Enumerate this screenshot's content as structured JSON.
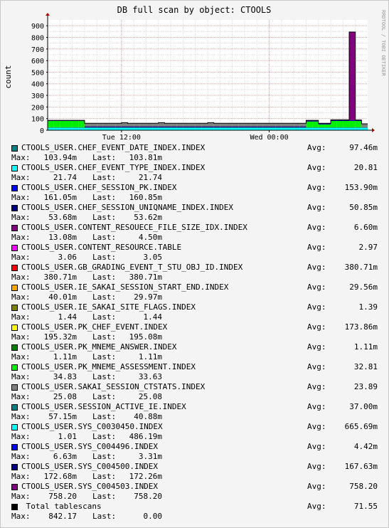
{
  "chart_data": {
    "type": "area",
    "title": "DB full scan by object: CTOOLS",
    "ylabel": "count",
    "watermark": "RRDTOOL / TOBI OETIKER",
    "ylim": [
      0,
      950
    ],
    "yticks": [
      0,
      100,
      200,
      300,
      400,
      500,
      600,
      700,
      800,
      900
    ],
    "ytick_labels": [
      "0",
      "100",
      "200",
      "300",
      "400",
      "500",
      "600",
      "700",
      "800",
      "900"
    ],
    "xlim": [
      0,
      52
    ],
    "xticks": [
      {
        "x": 12,
        "label": "Tue 12:00"
      },
      {
        "x": 36,
        "label": "Wed 00:00"
      }
    ],
    "grid": true,
    "x": [
      0,
      1,
      2,
      3,
      4,
      5,
      6,
      7,
      8,
      9,
      10,
      11,
      12,
      13,
      14,
      15,
      16,
      17,
      18,
      19,
      20,
      21,
      22,
      23,
      24,
      25,
      26,
      27,
      28,
      29,
      30,
      31,
      32,
      33,
      34,
      35,
      36,
      37,
      38,
      39,
      40,
      41,
      42,
      43,
      44,
      45,
      46,
      47,
      48,
      49,
      50,
      51
    ],
    "series": [
      {
        "name": "CTOOLS_USER.SYS_C0030450.INDEX",
        "color": "#00ffff",
        "values": [
          20,
          20,
          20,
          20,
          20,
          20,
          20,
          20,
          20,
          20,
          20,
          20,
          20,
          20,
          20,
          20,
          20,
          20,
          20,
          20,
          20,
          20,
          20,
          20,
          20,
          20,
          20,
          20,
          20,
          20,
          20,
          20,
          20,
          20,
          20,
          20,
          20,
          20,
          20,
          20,
          20,
          20,
          20,
          20,
          20,
          20,
          20,
          20,
          20,
          20,
          20,
          20
        ]
      },
      {
        "name": "CTOOLS_USER.SESSION_ACTIVE_IE.INDEX",
        "color": "#008080",
        "values": [
          5,
          5,
          5,
          5,
          5,
          5,
          5,
          5,
          5,
          5,
          5,
          5,
          5,
          5,
          5,
          5,
          5,
          5,
          5,
          5,
          5,
          5,
          5,
          5,
          5,
          5,
          5,
          5,
          5,
          5,
          5,
          5,
          5,
          5,
          5,
          5,
          5,
          5,
          5,
          5,
          5,
          5,
          5,
          5,
          5,
          5,
          5,
          5,
          5,
          5,
          5,
          5
        ]
      },
      {
        "name": "CTOOLS_USER.PK_MNEME_ASSESSMENT.INDEX",
        "color": "#00ee00",
        "values": [
          55,
          55,
          55,
          55,
          55,
          55,
          0,
          0,
          0,
          0,
          0,
          0,
          0,
          0,
          0,
          0,
          0,
          0,
          0,
          0,
          0,
          0,
          0,
          0,
          0,
          0,
          0,
          0,
          0,
          0,
          0,
          0,
          0,
          0,
          0,
          0,
          0,
          0,
          0,
          0,
          0,
          0,
          50,
          50,
          25,
          25,
          55,
          55,
          55,
          55,
          55,
          0
        ]
      },
      {
        "name": "CTOOLS_USER.CHEF_SESSION_UNIQNAME_INDEX.INDEX",
        "color": "#000080",
        "values": [
          3,
          3,
          3,
          3,
          3,
          3,
          8,
          8,
          8,
          8,
          8,
          8,
          8,
          8,
          8,
          8,
          8,
          8,
          8,
          8,
          8,
          8,
          8,
          8,
          8,
          8,
          8,
          8,
          8,
          8,
          8,
          8,
          8,
          8,
          8,
          8,
          8,
          8,
          8,
          8,
          8,
          8,
          8,
          8,
          8,
          8,
          8,
          8,
          8,
          8,
          8,
          0
        ]
      },
      {
        "name": "CTOOLS_USER.SAKAI_SESSION_CTSTATS.INDEX",
        "color": "#808080",
        "values": [
          0,
          0,
          0,
          0,
          0,
          0,
          25,
          25,
          25,
          25,
          25,
          25,
          30,
          25,
          25,
          25,
          25,
          25,
          30,
          25,
          25,
          25,
          25,
          25,
          25,
          25,
          30,
          25,
          25,
          25,
          25,
          25,
          25,
          25,
          25,
          25,
          25,
          25,
          25,
          25,
          25,
          25,
          0,
          0,
          0,
          0,
          0,
          0,
          0,
          0,
          0,
          30
        ]
      },
      {
        "name": "CTOOLS_USER.SYS_C004503.INDEX",
        "color": "#800080",
        "values": [
          2,
          2,
          2,
          2,
          2,
          2,
          2,
          2,
          2,
          2,
          2,
          2,
          2,
          2,
          2,
          2,
          2,
          2,
          2,
          2,
          2,
          2,
          2,
          2,
          2,
          2,
          2,
          2,
          2,
          2,
          2,
          2,
          2,
          2,
          2,
          2,
          2,
          2,
          2,
          2,
          2,
          2,
          2,
          2,
          2,
          2,
          2,
          2,
          2,
          758,
          0,
          0
        ]
      }
    ],
    "legend": [
      {
        "color": "#008080",
        "name": "CTOOLS_USER.CHEF_EVENT_DATE_INDEX.INDEX",
        "avg": "97.46m",
        "max": "103.94m",
        "last": "103.81m"
      },
      {
        "color": "#00ffff",
        "name": "CTOOLS_USER.CHEF_EVENT_TYPE_INDEX.INDEX",
        "avg": "20.81",
        "max": "21.74",
        "last": "21.74"
      },
      {
        "color": "#0000ff",
        "name": "CTOOLS_USER.CHEF_SESSION_PK.INDEX",
        "avg": "153.90m",
        "max": "161.05m",
        "last": "160.85m"
      },
      {
        "color": "#000080",
        "name": "CTOOLS_USER.CHEF_SESSION_UNIQNAME_INDEX.INDEX",
        "avg": "50.85m",
        "max": "53.68m",
        "last": "53.62m"
      },
      {
        "color": "#800080",
        "name": "CTOOLS_USER.CONTENT_RESOUECE_FILE_SIZE_IDX.INDEX",
        "avg": "6.60m",
        "max": "13.08m",
        "last": "4.50m"
      },
      {
        "color": "#ff00ff",
        "name": "CTOOLS_USER.CONTENT_RESOURCE.TABLE",
        "avg": "2.97",
        "max": "3.06",
        "last": "3.05"
      },
      {
        "color": "#ff0000",
        "name": "CTOOLS_USER.GB_GRADING_EVENT_T_STU_OBJ_ID.INDEX",
        "avg": "380.71m",
        "max": "380.71m",
        "last": "380.71m"
      },
      {
        "color": "#ffa500",
        "name": "CTOOLS_USER.IE_SAKAI_SESSION_START_END.INDEX",
        "avg": "29.56m",
        "max": "40.01m",
        "last": "29.97m"
      },
      {
        "color": "#808000",
        "name": "CTOOLS_USER.IE_SAKAI_SITE_FLAGS.INDEX",
        "avg": "1.39",
        "max": "1.44",
        "last": "1.44"
      },
      {
        "color": "#ffff00",
        "name": "CTOOLS_USER.PK_CHEF_EVENT.INDEX",
        "avg": "173.86m",
        "max": "195.32m",
        "last": "195.08m"
      },
      {
        "color": "#008000",
        "name": "CTOOLS_USER.PK_MNEME_ANSWER.INDEX",
        "avg": "1.11m",
        "max": "1.11m",
        "last": "1.11m"
      },
      {
        "color": "#00ee00",
        "name": "CTOOLS_USER.PK_MNEME_ASSESSMENT.INDEX",
        "avg": "32.81",
        "max": "34.83",
        "last": "33.63"
      },
      {
        "color": "#808080",
        "name": "CTOOLS_USER.SAKAI_SESSION_CTSTATS.INDEX",
        "avg": "23.89",
        "max": "25.08",
        "last": "25.08"
      },
      {
        "color": "#008080",
        "name": "CTOOLS_USER.SESSION_ACTIVE_IE.INDEX",
        "avg": "37.00m",
        "max": "57.15m",
        "last": "40.88m"
      },
      {
        "color": "#00ffff",
        "name": "CTOOLS_USER.SYS_C0030450.INDEX",
        "avg": "665.69m",
        "max": "1.01",
        "last": "486.19m"
      },
      {
        "color": "#0000ff",
        "name": "CTOOLS_USER.SYS_C004496.INDEX",
        "avg": "4.42m",
        "max": "6.63m",
        "last": "3.31m"
      },
      {
        "color": "#000080",
        "name": "CTOOLS_USER.SYS_C004500.INDEX",
        "avg": "167.63m",
        "max": "172.68m",
        "last": "172.26m"
      },
      {
        "color": "#800080",
        "name": "CTOOLS_USER.SYS_C004503.INDEX",
        "avg": "758.20",
        "max": "758.20",
        "last": "758.20"
      },
      {
        "color": "#000000",
        "name": " Total tablescans",
        "avg": "71.55",
        "max": "842.17",
        "last": "0.00"
      }
    ],
    "labels": {
      "avg": "Avg:",
      "max": "Max:",
      "last": "Last:"
    }
  }
}
